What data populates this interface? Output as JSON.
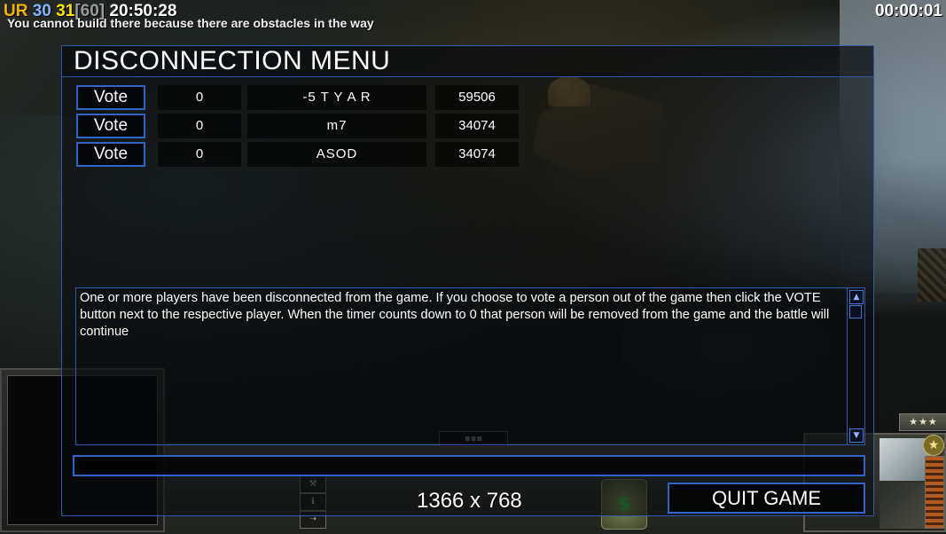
{
  "hud": {
    "faction": "UR",
    "stat1": "30",
    "stat2": "31",
    "fps": "[60]",
    "clock": "20:50:28",
    "warning": "You cannot build there because there are obstacles in the way",
    "timer": "00:00:01"
  },
  "dialog": {
    "title": "DISCONNECTION MENU",
    "vote_label": "Vote",
    "players": [
      {
        "votes": "0",
        "name": "-5 T Y A R",
        "ping": "59506"
      },
      {
        "votes": "0",
        "name": "m7",
        "ping": "34074"
      },
      {
        "votes": "0",
        "name": "ASOD",
        "ping": "34074"
      }
    ],
    "message": "One or more players have been disconnected from the game. If you choose to vote a person out of the game then click the VOTE button next to the respective player. When the timer counts down to 0 that person will be removed from the game and the battle will continue",
    "chat_value": "",
    "resolution": "1366 x 768",
    "quit_label": "QUIT GAME"
  },
  "colors": {
    "faction": "#f0b400",
    "stat1": "#7fb6ff",
    "stat2": "#ffe600",
    "fps": "#9a9a9a",
    "dialog_border": "#2e5aa8"
  },
  "icons": {
    "scroll_up": "triangle-up-icon",
    "scroll_down": "triangle-down-icon",
    "rank_stars": "stars-icon",
    "general_star": "star-icon",
    "dollar": "dollar-icon"
  }
}
